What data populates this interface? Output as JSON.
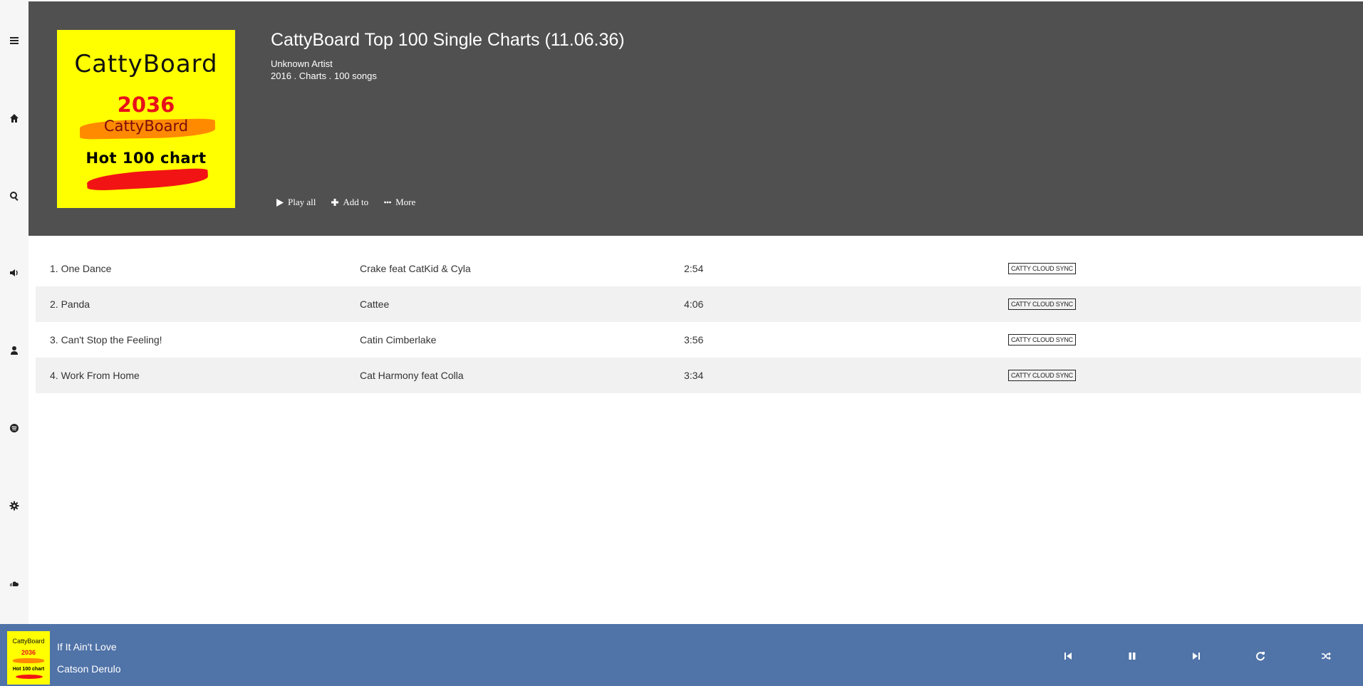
{
  "sidebar": {
    "items": [
      {
        "name": "menu-icon"
      },
      {
        "name": "home-icon"
      },
      {
        "name": "search-icon"
      },
      {
        "name": "volume-icon"
      },
      {
        "name": "user-icon"
      },
      {
        "name": "spotify-icon"
      },
      {
        "name": "gear-icon"
      },
      {
        "name": "soundcloud-icon"
      }
    ]
  },
  "album": {
    "cover": {
      "brand": "CattyBoard",
      "year": "2036",
      "sub": "CattyBoard",
      "caption": "Hot 100 chart",
      "bg_color": "#ffff00"
    },
    "title": "CattyBoard Top 100 Single Charts (11.06.36)",
    "artist": "Unknown Artist",
    "meta": "2016 . Charts . 100 songs",
    "actions": {
      "play_all": "Play all",
      "add_to": "Add to",
      "more": "More"
    }
  },
  "tracks": [
    {
      "title": "1. One Dance",
      "artist": "Crake feat CatKid & Cyla",
      "duration": "2:54",
      "badge": "CATTY CLOUD SYNC"
    },
    {
      "title": "2. Panda",
      "artist": "Cattee",
      "duration": "4:06",
      "badge": "CATTY CLOUD SYNC"
    },
    {
      "title": "3. Can't Stop the Feeling!",
      "artist": "Catin Cimberlake",
      "duration": "3:56",
      "badge": "CATTY CLOUD SYNC"
    },
    {
      "title": "4. Work From Home",
      "artist": "Cat Harmony feat Colla",
      "duration": "3:34",
      "badge": "CATTY CLOUD SYNC"
    }
  ],
  "player": {
    "title": "If It Ain't Love",
    "artist": "Catson Derulo",
    "controls": [
      "previous-icon",
      "pause-icon",
      "next-icon",
      "repeat-icon",
      "shuffle-icon"
    ]
  },
  "colors": {
    "header_bg": "#505050",
    "player_bg": "#5073a8",
    "sidebar_bg": "#f6f6f6",
    "row_alt_bg": "#f1f1f1"
  }
}
